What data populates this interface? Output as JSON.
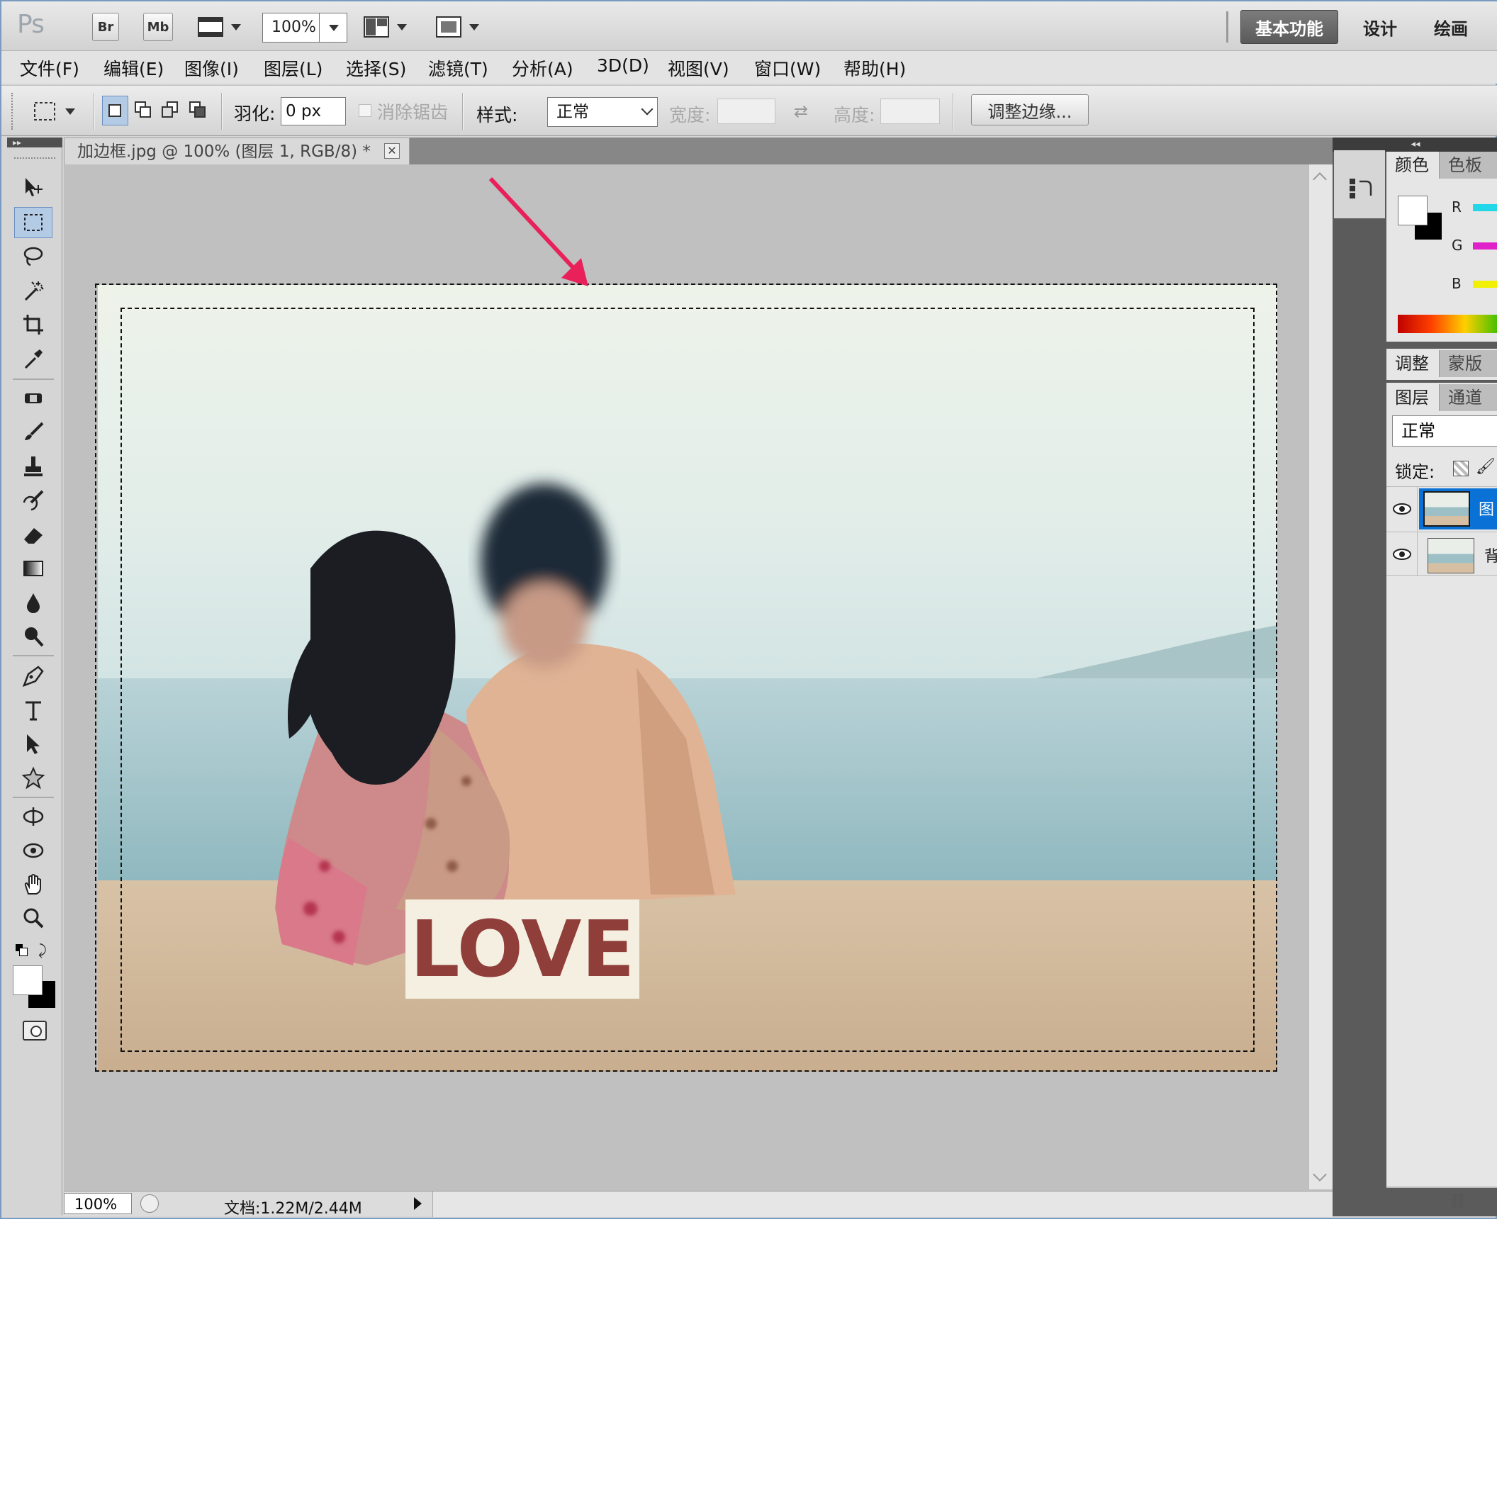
{
  "app": {
    "logo": "Ps",
    "zoom": "100%",
    "bridge_label": "Br",
    "minibridge_label": "Mb"
  },
  "workspaces": [
    "基本功能",
    "设计",
    "绘画"
  ],
  "menu": [
    "文件(F)",
    "编辑(E)",
    "图像(I)",
    "图层(L)",
    "选择(S)",
    "滤镜(T)",
    "分析(A)",
    "3D(D)",
    "视图(V)",
    "窗口(W)",
    "帮助(H)"
  ],
  "options": {
    "feather_label": "羽化:",
    "feather_value": "0 px",
    "antialias_label": "消除锯齿",
    "style_label": "样式:",
    "style_value": "正常",
    "width_label": "宽度:",
    "height_label": "高度:",
    "refine_edge": "调整边缘..."
  },
  "document": {
    "tab_title": "加边框.jpg @ 100% (图层 1, RGB/8) *",
    "close": "✕"
  },
  "photo": {
    "sign_text": "LOVE"
  },
  "status": {
    "zoom": "100%",
    "doc_size": "文档:1.22M/2.44M"
  },
  "panels": {
    "color_tabs": [
      "颜色",
      "色板"
    ],
    "rgb": [
      "R",
      "G",
      "B"
    ],
    "adjust_tabs": [
      "调整",
      "蒙版"
    ],
    "layer_tabs": [
      "图层",
      "通道"
    ],
    "blend_mode": "正常",
    "lock_label": "锁定:",
    "layer1_name_partial": "图",
    "layer2_name_partial": "背"
  },
  "colors": {
    "accent": "#0a72d6",
    "annotation_arrow": "#e8215a",
    "r_bar": "#22d8e8",
    "g_bar": "#e020c8",
    "b_bar": "#f0f000"
  }
}
